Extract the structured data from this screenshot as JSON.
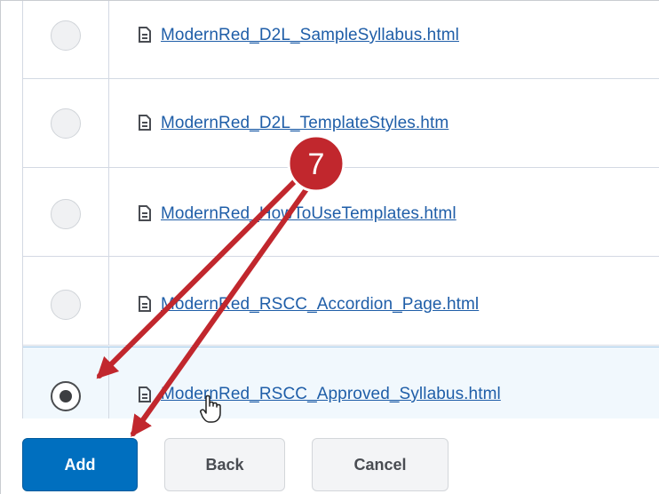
{
  "files": [
    {
      "name": "ModernRed_D2L_SampleSyllabus.html",
      "selected": false
    },
    {
      "name": "ModernRed_D2L_TemplateStyles.htm",
      "selected": false
    },
    {
      "name": "ModernRed_HowToUseTemplates.html",
      "selected": false
    },
    {
      "name": "ModernRed_RSCC_Accordion_Page.html",
      "selected": false
    },
    {
      "name": "ModernRed_RSCC_Approved_Syllabus.html",
      "selected": true
    }
  ],
  "buttons": {
    "add_label": "Add",
    "back_label": "Back",
    "cancel_label": "Cancel"
  },
  "annotation": {
    "step_number": "7",
    "color": "#c1272d"
  },
  "colors": {
    "link": "#1f5ea8",
    "primary_button": "#006fbf",
    "selected_row": "#f1f8fd"
  }
}
